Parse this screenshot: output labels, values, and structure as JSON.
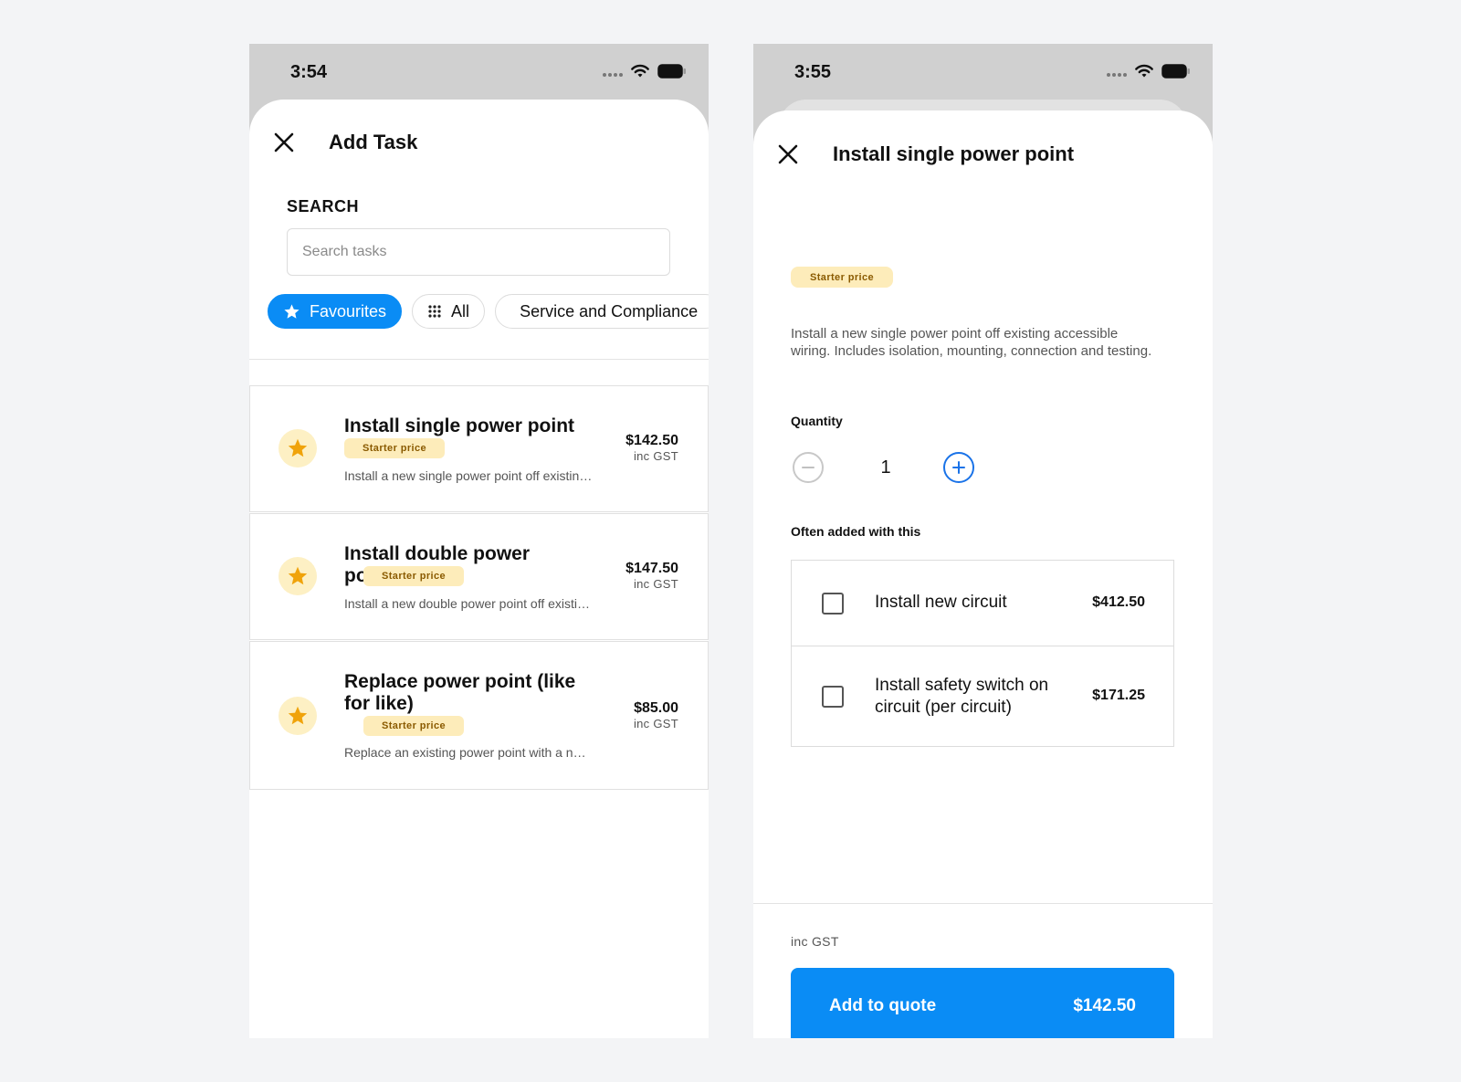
{
  "left": {
    "status": {
      "time": "3:54"
    },
    "title": "Add Task",
    "search": {
      "label": "SEARCH",
      "placeholder": "Search tasks",
      "value": ""
    },
    "filters": [
      {
        "label": "Favourites",
        "icon": "star-icon",
        "active": true
      },
      {
        "label": "All",
        "icon": "grid-icon",
        "active": false
      },
      {
        "label": "Service and Compliance",
        "icon": null,
        "active": false
      }
    ],
    "tasks": [
      {
        "title": "Install single power point",
        "badge": "Starter price",
        "description": "Install a new single power point off existing accessible wiring. Includes isolation, mounting, connection and testing.",
        "price": "$142.50",
        "price_note": "inc GST",
        "favourite": true
      },
      {
        "title": "Install double power point",
        "badge": "Starter price",
        "description": "Install a new double power point off existing accessible wiring.",
        "price": "$147.50",
        "price_note": "inc GST",
        "favourite": true
      },
      {
        "title": "Replace power point (like for like)",
        "badge": "Starter price",
        "description": "Replace an existing power point with a new one.",
        "price": "$85.00",
        "price_note": "inc GST",
        "favourite": true
      }
    ]
  },
  "right": {
    "status": {
      "time": "3:55"
    },
    "title": "Install single power point",
    "badge": "Starter price",
    "description": "Install a new single power point off existing accessible wiring. Includes isolation, mounting, connection and testing.",
    "quantity_label": "Quantity",
    "quantity": "1",
    "addons_label": "Often added with this",
    "addons": [
      {
        "name": "Install new circuit",
        "price": "$412.50",
        "checked": false
      },
      {
        "name": "Install safety switch on circuit (per circuit)",
        "price": "$171.25",
        "checked": false
      }
    ],
    "footer_note": "inc GST",
    "cta": {
      "label": "Add to quote",
      "price": "$142.50"
    }
  },
  "colors": {
    "primary": "#0a8cf5",
    "badge_bg": "#fdecba",
    "badge_text": "#8a5a00",
    "star": "#f0a30a",
    "star_bg": "#fdf0c4",
    "background": "#f3f4f6"
  }
}
